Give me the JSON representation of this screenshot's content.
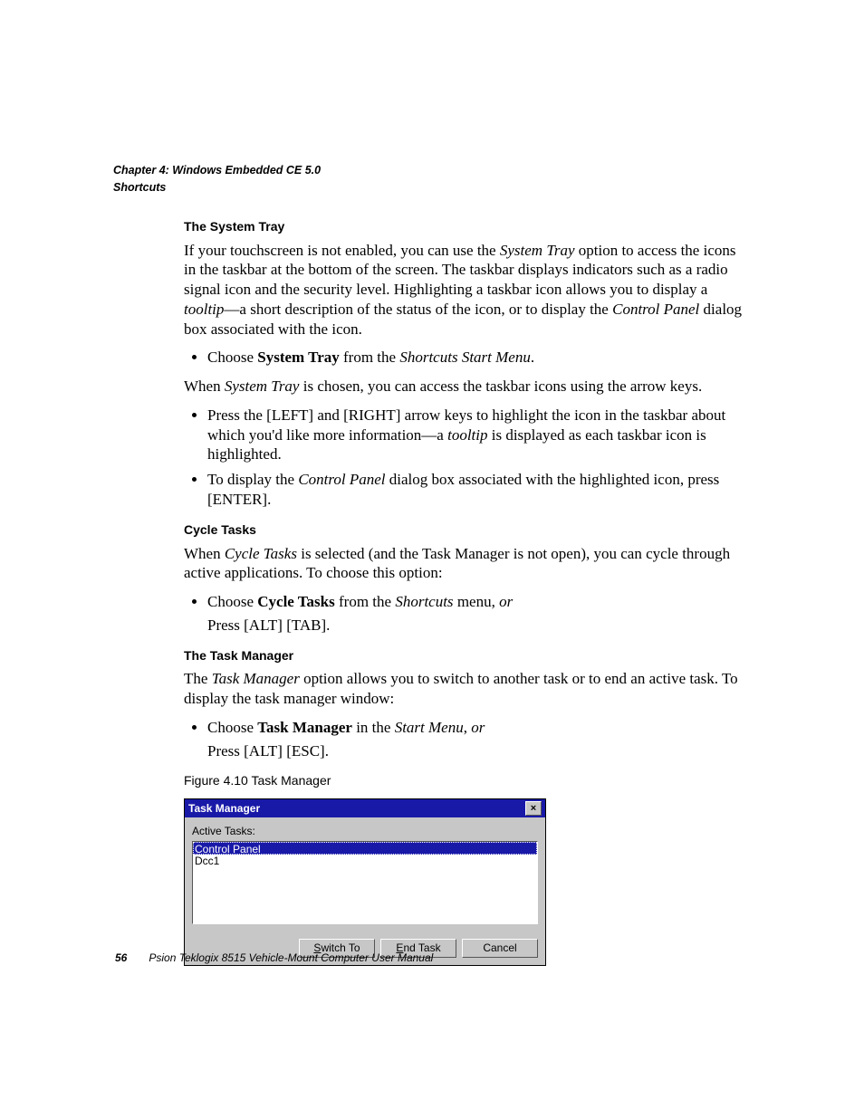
{
  "header": {
    "chapter": "Chapter 4: Windows Embedded CE 5.0",
    "section": "Shortcuts"
  },
  "sections": {
    "systemTray": {
      "title": "The System Tray",
      "para1_a": "If your touchscreen is not enabled, you can use the ",
      "para1_b": "System Tray",
      "para1_c": " option to access the icons in the taskbar at the bottom of the screen. The taskbar displays indicators such as a radio signal icon and the security level. Highlighting a taskbar icon allows you to display a ",
      "para1_d": "tooltip",
      "para1_e": "—a short description of the status of the icon, or to display the ",
      "para1_f": "Control Panel",
      "para1_g": " dialog box associated with the icon.",
      "bullet1_a": "Choose ",
      "bullet1_b": "System Tray",
      "bullet1_c": " from the ",
      "bullet1_d": "Shortcuts Start Menu",
      "bullet1_e": ".",
      "para2_a": "When ",
      "para2_b": "System Tray",
      "para2_c": " is chosen, you can access the taskbar icons using the arrow keys.",
      "bullet2_a": "Press the [LEFT] and [RIGHT] arrow keys to highlight the icon in the taskbar about which you'd like more information—a ",
      "bullet2_b": "tooltip",
      "bullet2_c": " is displayed as each taskbar icon is highlighted.",
      "bullet3_a": "To display the ",
      "bullet3_b": "Control Panel",
      "bullet3_c": " dialog box associated with the highlighted icon, press [ENTER]."
    },
    "cycleTasks": {
      "title": "Cycle Tasks",
      "para1_a": "When ",
      "para1_b": "Cycle Tasks",
      "para1_c": " is selected (and the Task Manager is not open), you can cycle through active applications. To choose this option:",
      "bullet1_a": "Choose ",
      "bullet1_b": "Cycle Tasks",
      "bullet1_c": " from the ",
      "bullet1_d": "Shortcuts",
      "bullet1_e": " menu, ",
      "bullet1_f": "or",
      "bullet1_g": "Press [ALT] [TAB]."
    },
    "taskManager": {
      "title": "The Task Manager",
      "para1_a": "The ",
      "para1_b": "Task Manager",
      "para1_c": " option allows you to switch to another task or to end an active task. To display the task manager window:",
      "bullet1_a": "Choose ",
      "bullet1_b": "Task Manager",
      "bullet1_c": " in the ",
      "bullet1_d": "Start Menu",
      "bullet1_e": ", ",
      "bullet1_f": "or",
      "bullet1_g": "Press [ALT] [ESC]."
    }
  },
  "figure": {
    "caption": "Figure 4.10 Task Manager",
    "dialog": {
      "title": "Task Manager",
      "close": "×",
      "label": "Active Tasks:",
      "items": {
        "0": "Control Panel",
        "1": "Dcc1"
      },
      "buttons": {
        "switch": "Switch To",
        "end": "End Task",
        "cancel": "Cancel"
      }
    }
  },
  "footer": {
    "page": "56",
    "text": "Psion Teklogix 8515 Vehicle-Mount Computer User Manual"
  }
}
